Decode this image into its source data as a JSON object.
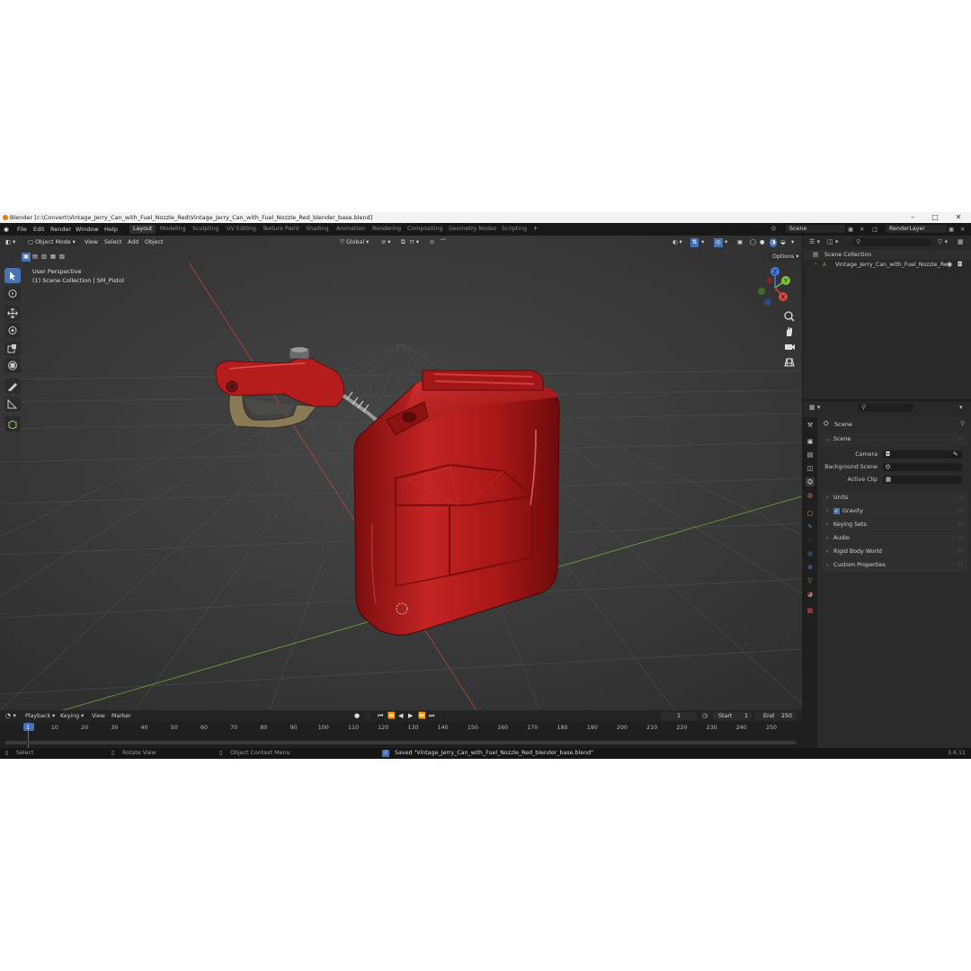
{
  "window": {
    "title": "Blender [c:\\Convert\\Vintage_Jerry_Can_with_Fuel_Nozzle_Red\\Vintage_Jerry_Can_with_Fuel_Nozzle_Red_blender_base.blend]",
    "minimize": "–",
    "maximize": "□",
    "close": "✕"
  },
  "menu": [
    "File",
    "Edit",
    "Render",
    "Window",
    "Help"
  ],
  "workspaces": [
    "Layout",
    "Modeling",
    "Sculpting",
    "UV Editing",
    "Texture Paint",
    "Shading",
    "Animation",
    "Rendering",
    "Compositing",
    "Geometry Nodes",
    "Scripting",
    "+"
  ],
  "active_workspace": "Layout",
  "scene_field": "Scene",
  "view_layer_field": "RenderLayer",
  "viewport": {
    "mode": "Object Mode",
    "menus": [
      "View",
      "Select",
      "Add",
      "Object"
    ],
    "transform_orientation": "Global",
    "options": "Options",
    "overlay_line1": "User Perspective",
    "overlay_line2": "(1) Scene Collection | SM_Pistol",
    "gizmo_axes": [
      "Z",
      "Y",
      "X"
    ]
  },
  "outliner": {
    "root": "Scene Collection",
    "item": "Vintage_Jerry_Can_with_Fuel_Nozzle_Re"
  },
  "properties": {
    "header": "Scene",
    "section": "Scene",
    "rows": [
      {
        "label": "Camera"
      },
      {
        "label": "Background Scene"
      },
      {
        "label": "Active Clip"
      }
    ],
    "panels": [
      "Units",
      "Gravity",
      "Keying Sets",
      "Audio",
      "Rigid Body World",
      "Custom Properties"
    ],
    "gravity_checked": true
  },
  "timeline": {
    "menus": [
      "Playback",
      "Keying",
      "View",
      "Marker"
    ],
    "current_frame": "1",
    "start_label": "Start",
    "start": "1",
    "end_label": "End",
    "end": "250",
    "ticks": [
      "1",
      "10",
      "20",
      "30",
      "40",
      "50",
      "60",
      "70",
      "80",
      "90",
      "100",
      "110",
      "120",
      "130",
      "140",
      "150",
      "160",
      "170",
      "180",
      "190",
      "200",
      "210",
      "220",
      "230",
      "240",
      "250"
    ]
  },
  "status": {
    "select": "Select",
    "rotate": "Rotate View",
    "context": "Object Context Menu",
    "message": "Saved \"Vintage_Jerry_Can_with_Fuel_Nozzle_Red_blender_base.blend\"",
    "version": "3.6.11"
  },
  "colors": {
    "accent": "#4772b3",
    "can_red": "#b81e1e",
    "axis_x": "#d8473f",
    "axis_y": "#7ec03b",
    "axis_z": "#3f7ae6"
  }
}
